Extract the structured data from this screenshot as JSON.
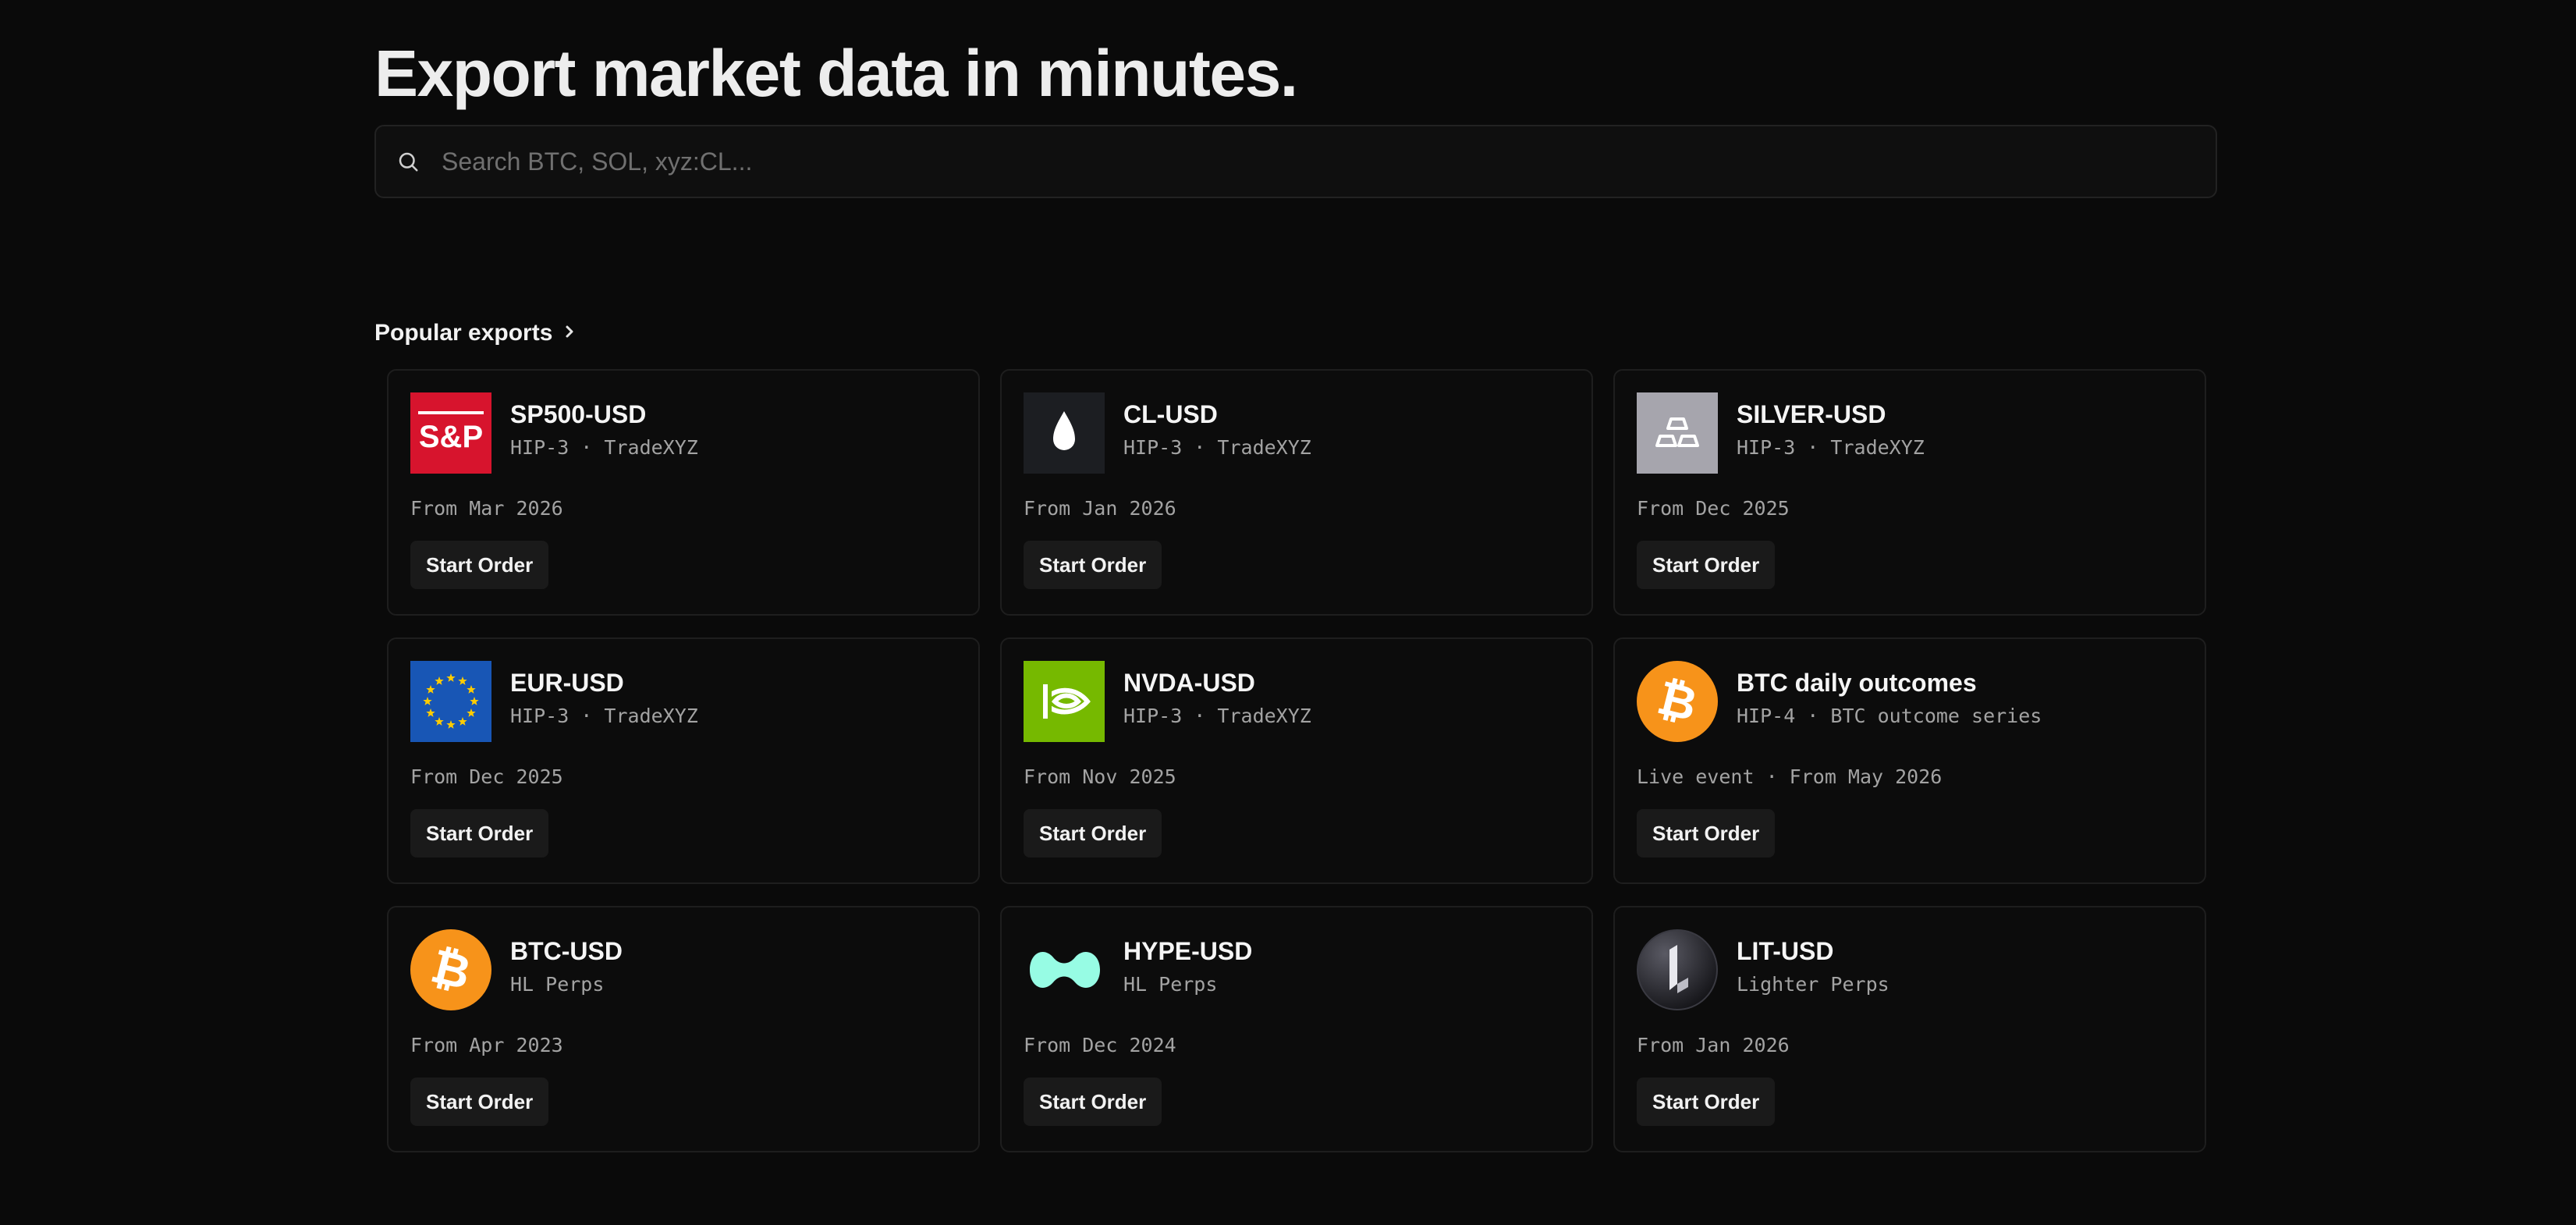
{
  "hero": {
    "title": "Export market data in minutes."
  },
  "search": {
    "placeholder": "Search BTC, SOL, xyz:CL...",
    "value": ""
  },
  "section": {
    "label": "Popular exports",
    "icon": "chevron-right-icon"
  },
  "cards": [
    {
      "name": "SP500-USD",
      "sub": "HIP-3 · TradeXYZ",
      "from": "From Mar 2026",
      "button": "Start Order",
      "icon": "sp500-logo-icon",
      "logo_text": "S&P",
      "color": "#d7142d"
    },
    {
      "name": "CL-USD",
      "sub": "HIP-3 · TradeXYZ",
      "from": "From Jan 2026",
      "button": "Start Order",
      "icon": "oil-drop-icon",
      "color": "#1c1e22"
    },
    {
      "name": "SILVER-USD",
      "sub": "HIP-3 · TradeXYZ",
      "from": "From Dec 2025",
      "button": "Start Order",
      "icon": "silver-bars-icon",
      "color": "#a6a5ad"
    },
    {
      "name": "EUR-USD",
      "sub": "HIP-3 · TradeXYZ",
      "from": "From Dec 2025",
      "button": "Start Order",
      "icon": "eu-flag-icon",
      "color": "#1856b5"
    },
    {
      "name": "NVDA-USD",
      "sub": "HIP-3 · TradeXYZ",
      "from": "From Nov 2025",
      "button": "Start Order",
      "icon": "nvidia-logo-icon",
      "color": "#76b900"
    },
    {
      "name": "BTC daily outcomes",
      "sub": "HIP-4 · BTC outcome series",
      "from": "Live event · From May 2026",
      "button": "Start Order",
      "icon": "bitcoin-icon",
      "color": "#f7931a"
    },
    {
      "name": "BTC-USD",
      "sub": "HL Perps",
      "from": "From Apr 2023",
      "button": "Start Order",
      "icon": "bitcoin-icon",
      "color": "#f7931a"
    },
    {
      "name": "HYPE-USD",
      "sub": "HL Perps",
      "from": "From Dec 2024",
      "button": "Start Order",
      "icon": "hyperliquid-logo-icon",
      "color": "#97fce4"
    },
    {
      "name": "LIT-USD",
      "sub": "Lighter Perps",
      "from": "From Jan 2026",
      "button": "Start Order",
      "icon": "lighter-logo-icon",
      "color": "#2a2a30"
    }
  ]
}
